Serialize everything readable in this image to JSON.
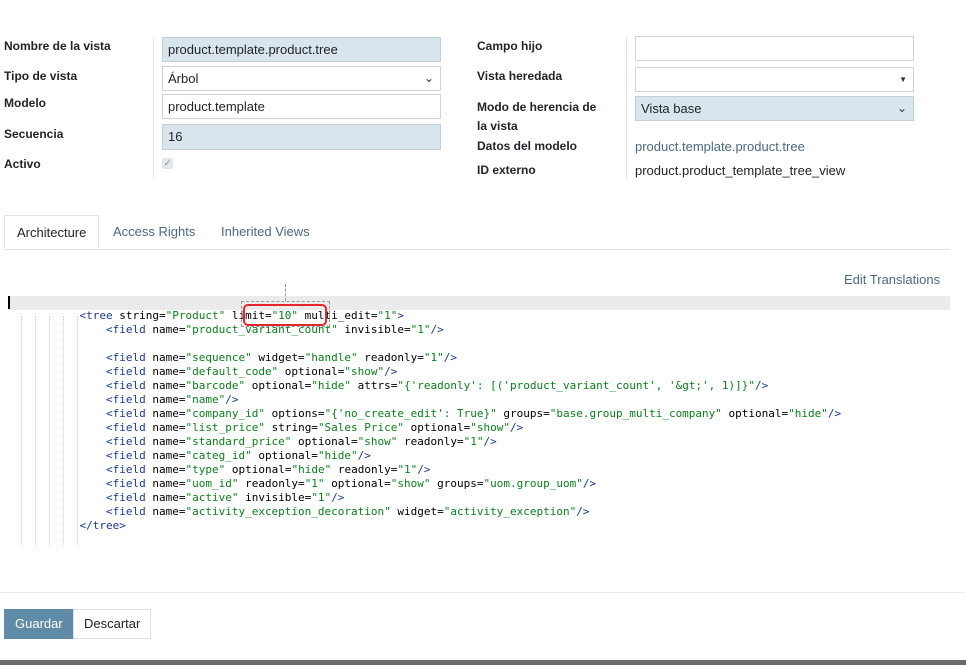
{
  "form": {
    "left": {
      "name_label": "Nombre de la vista",
      "name_value": "product.template.product.tree",
      "type_label": "Tipo de vista",
      "type_value": "Árbol",
      "model_label": "Modelo",
      "model_value": "product.template",
      "sequence_label": "Secuencia",
      "sequence_value": "16",
      "active_label": "Activo",
      "active_checked": true
    },
    "right": {
      "child_field_label": "Campo hijo",
      "child_field_value": "",
      "inherited_view_label": "Vista heredada",
      "inherited_view_value": "",
      "inherit_mode_label_1": "Modo de herencia de",
      "inherit_mode_label_2": "la vista",
      "inherit_mode_value": "Vista base",
      "model_data_label": "Datos del modelo",
      "model_data_value": "product.template.product.tree",
      "external_id_label": "ID externo",
      "external_id_value": "product.product_template_tree_view"
    }
  },
  "tabs": [
    {
      "label": "Architecture",
      "active": true
    },
    {
      "label": "Access Rights",
      "active": false
    },
    {
      "label": "Inherited Views",
      "active": false
    }
  ],
  "edit_translations": "Edit Translations",
  "code_lines": [
    "            <tree string=\"Product\" limit=\"10\" multi_edit=\"1\">",
    "                <field name=\"product_variant_count\" invisible=\"1\"/>",
    "",
    "                <field name=\"sequence\" widget=\"handle\" readonly=\"1\"/>",
    "                <field name=\"default_code\" optional=\"show\"/>",
    "                <field name=\"barcode\" optional=\"hide\" attrs=\"{'readonly': [('product_variant_count', '&gt;', 1)]}\"/>",
    "                <field name=\"name\"/>",
    "                <field name=\"company_id\" options=\"{'no_create_edit': True}\" groups=\"base.group_multi_company\" optional=\"hide\"/>",
    "                <field name=\"list_price\" string=\"Sales Price\" optional=\"show\"/>",
    "                <field name=\"standard_price\" optional=\"show\" readonly=\"1\"/>",
    "                <field name=\"categ_id\" optional=\"hide\"/>",
    "                <field name=\"type\" optional=\"hide\" readonly=\"1\"/>",
    "                <field name=\"uom_id\" readonly=\"1\" optional=\"show\" groups=\"uom.group_uom\"/>",
    "                <field name=\"active\" invisible=\"1\"/>",
    "                <field name=\"activity_exception_decoration\" widget=\"activity_exception\"/>",
    "            </tree>"
  ],
  "buttons": {
    "save": "Guardar",
    "discard": "Descartar"
  },
  "colors": {
    "primary": "#5f8ba6",
    "link": "#4c6a7f",
    "readonly_bg": "#d9e5ec",
    "highlight": "#e2262a"
  }
}
